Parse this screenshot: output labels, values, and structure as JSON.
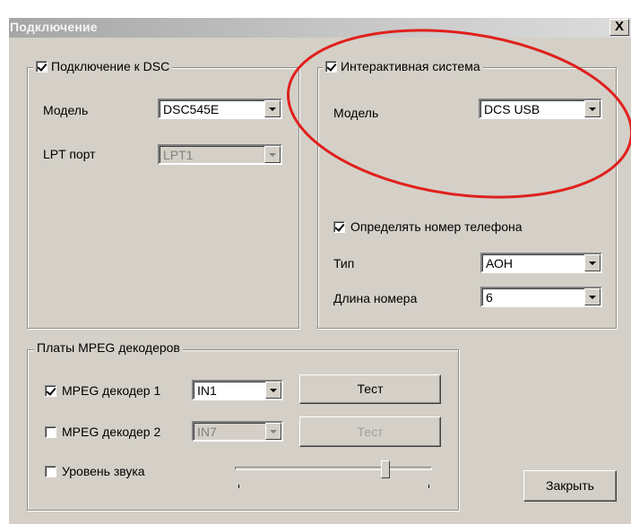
{
  "window": {
    "title": "Подключение",
    "close_label": "X"
  },
  "dsc_group": {
    "title": "Подключение к DSC",
    "checked": true,
    "model_label": "Модель",
    "model_value": "DSC545E",
    "lpt_label": "LPT порт",
    "lpt_value": "LPT1"
  },
  "interactive_group": {
    "title": "Интерактивная система",
    "checked": true,
    "model_label": "Модель",
    "model_value": "DCS USB",
    "detect_phone_label": "Определять номер телефона",
    "detect_phone_checked": true,
    "type_label": "Тип",
    "type_value": "АОН",
    "length_label": "Длина номера",
    "length_value": "6"
  },
  "mpeg_group": {
    "title": "Платы MPEG декодеров",
    "decoder1_label": "MPEG декодер 1",
    "decoder1_checked": true,
    "decoder1_input": "IN1",
    "decoder1_test": "Тест",
    "decoder2_label": "MPEG декодер 2",
    "decoder2_checked": false,
    "decoder2_input": "IN7",
    "decoder2_test": "Тест",
    "sound_label": "Уровень звука",
    "sound_checked": false
  },
  "footer": {
    "close_button": "Закрыть"
  },
  "annotation_color": "#e0201c"
}
